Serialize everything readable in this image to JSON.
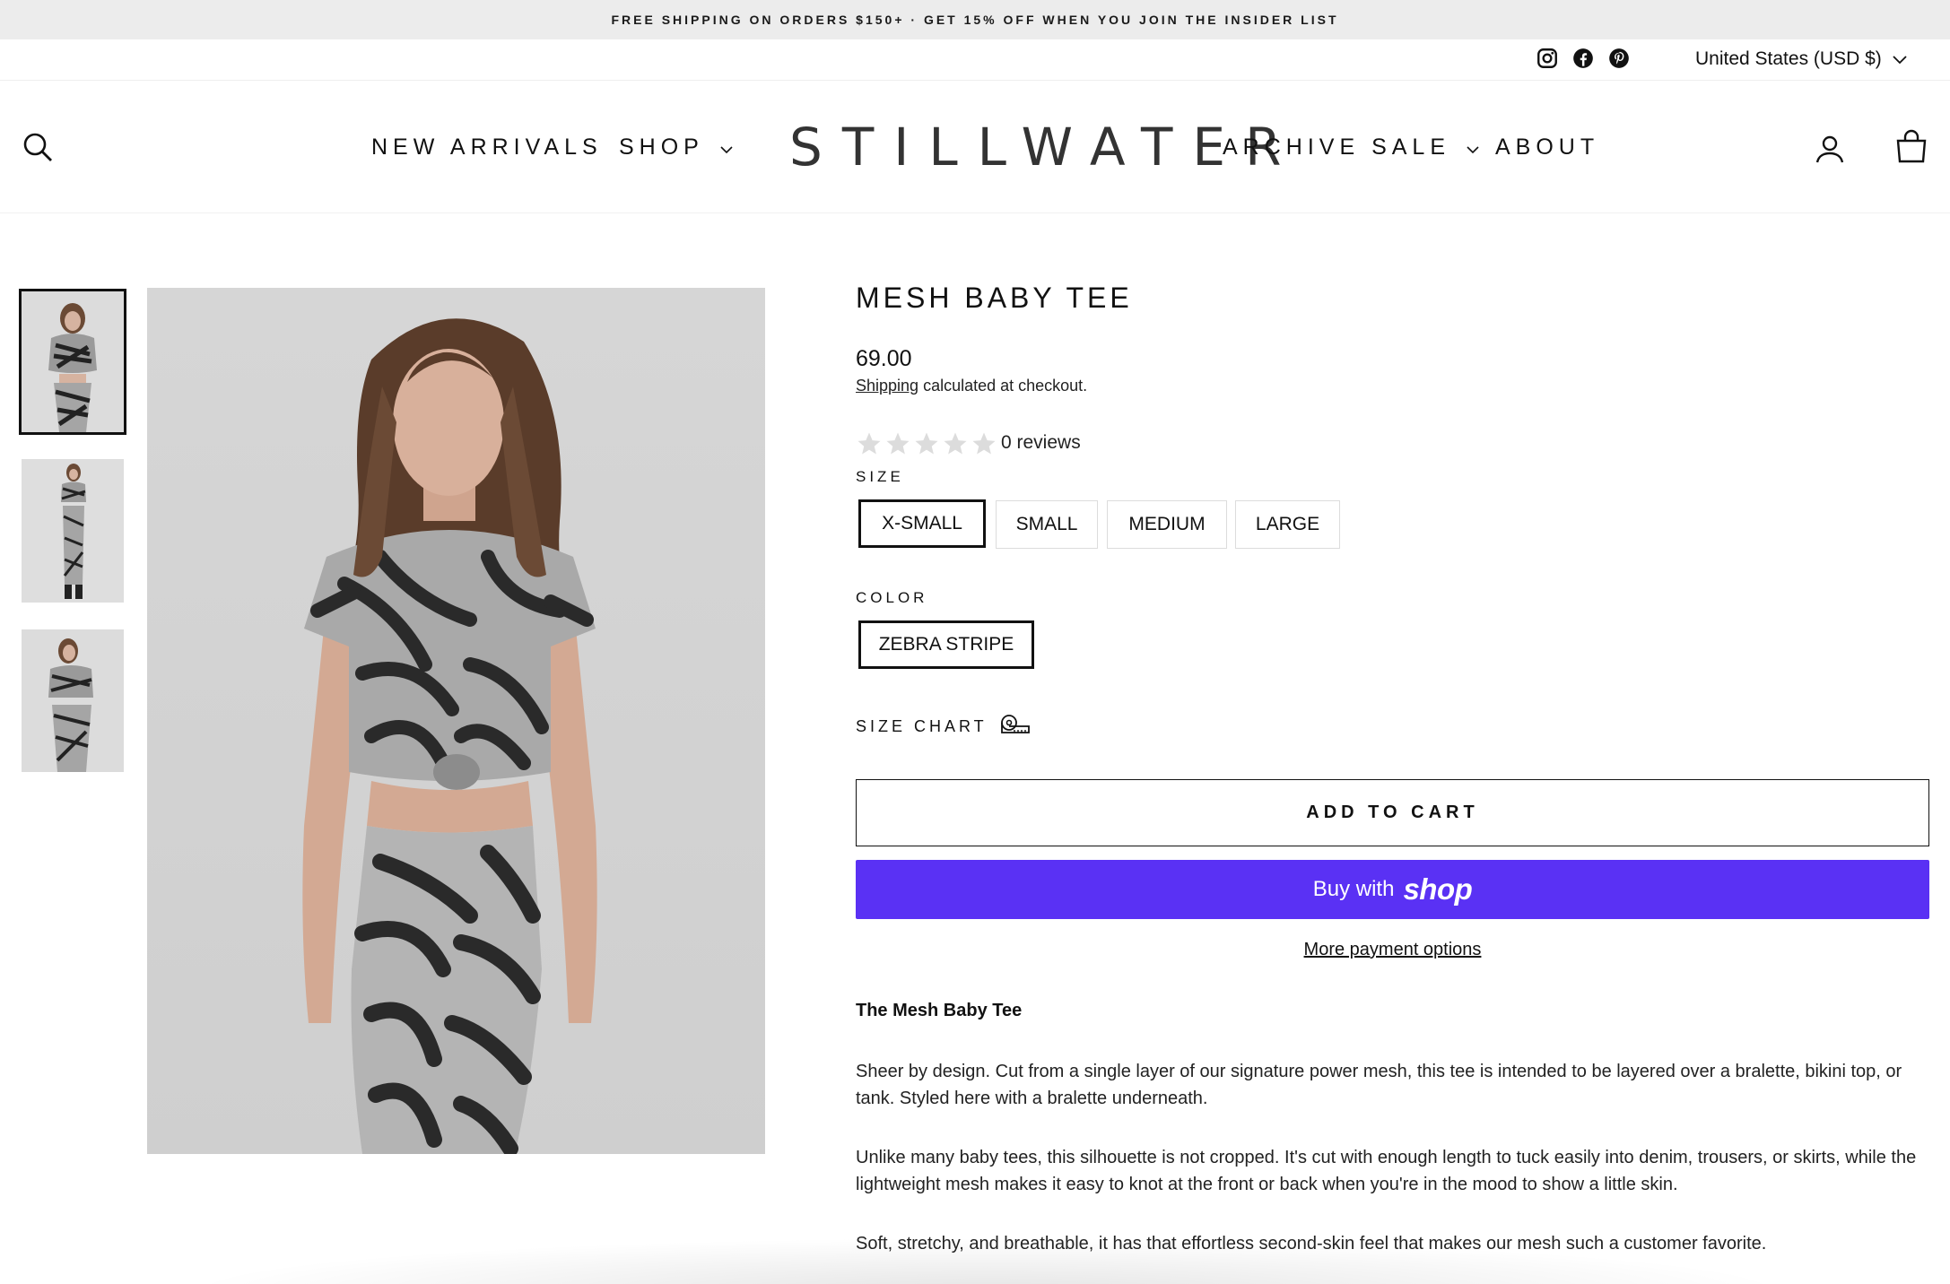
{
  "announcement": "FREE SHIPPING ON ORDERS $150+ · GET 15% OFF WHEN YOU JOIN THE INSIDER LIST",
  "utility": {
    "social_icons": [
      "instagram-icon",
      "facebook-icon",
      "pinterest-icon"
    ],
    "currency": "United States (USD $)"
  },
  "header": {
    "logo": "STILLWATER",
    "nav_left": [
      "NEW ARRIVALS",
      "SHOP"
    ],
    "nav_right": [
      "ARCHIVE SALE",
      "ABOUT"
    ],
    "icons": [
      "search-icon",
      "account-icon",
      "cart-icon"
    ]
  },
  "gallery": {
    "thumbnail_count": 3,
    "active_thumbnail": 1
  },
  "product": {
    "title": "MESH BABY TEE",
    "price": "69.00",
    "shipping_link": "Shipping",
    "shipping_text": " calculated at checkout.",
    "rating_stars": 0,
    "reviews": "0 reviews",
    "size_label": "SIZE",
    "sizes": [
      "X-SMALL",
      "SMALL",
      "MEDIUM",
      "LARGE"
    ],
    "selected_size": "X-SMALL",
    "color_label": "COLOR",
    "colors": [
      "ZEBRA STRIPE"
    ],
    "selected_color": "ZEBRA STRIPE",
    "size_chart": "SIZE CHART",
    "add_to_cart": "ADD TO CART",
    "buy_with": "Buy with",
    "shop_brand": "shop",
    "more_payment": "More payment options",
    "brand_color": "#5a31f4"
  },
  "description": {
    "heading": "The Mesh Baby Tee",
    "paragraphs": [
      "Sheer by design. Cut from a single layer of our signature power mesh, this tee is intended to be layered over a bralette, bikini top, or tank. Styled here with a bralette underneath.",
      "Unlike many baby tees, this silhouette is not cropped. It's cut with enough length to tuck easily into denim, trousers, or skirts, while the lightweight mesh makes it easy to knot at the front or back when you're in the mood to show a little skin.",
      "Soft, stretchy, and breathable, it has that effortless second-skin feel that makes our mesh such a customer favorite."
    ]
  }
}
